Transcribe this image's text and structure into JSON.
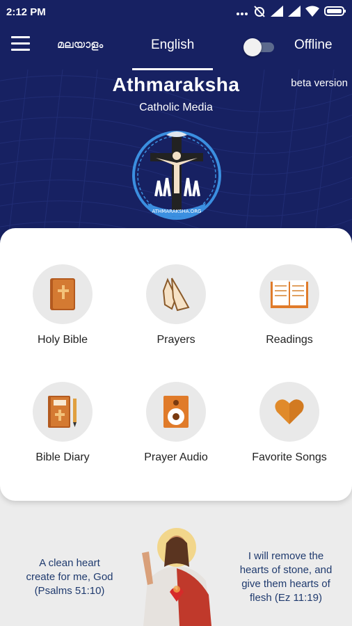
{
  "status": {
    "time": "2:12 PM"
  },
  "header": {
    "tab_malayalam": "മലയാളം",
    "tab_english": "English",
    "offline_label": "Offline"
  },
  "hero": {
    "title": "Athmaraksha",
    "subtitle": "Catholic Media",
    "beta": "beta version",
    "logo_text": "ATHMARAKSHA.ORG"
  },
  "menu": {
    "holy_bible": "Holy Bible",
    "prayers": "Prayers",
    "readings": "Readings",
    "bible_diary": "Bible Diary",
    "prayer_audio": "Prayer Audio",
    "favorite_songs": "Favorite Songs"
  },
  "quotes": {
    "left": [
      "A clean heart",
      "create for me, God",
      "(Psalms 51:10)"
    ],
    "right": [
      "I will remove the",
      "hearts of stone, and",
      "give them hearts of",
      "flesh (Ez 11:19)"
    ]
  },
  "colors": {
    "primary": "#172162",
    "accent": "#e07b2a",
    "quote": "#1f3a6e"
  }
}
